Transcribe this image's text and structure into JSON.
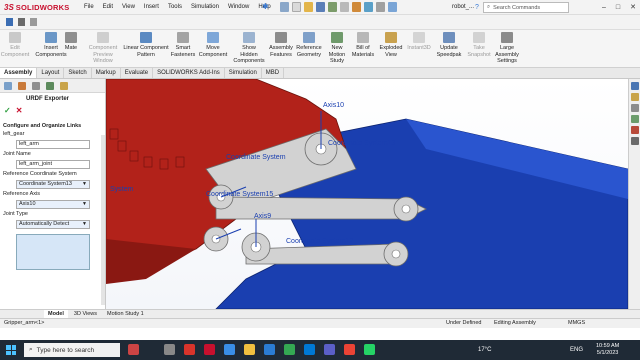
{
  "app": {
    "brand": "SOLIDWORKS",
    "doc_title": "robot_...",
    "search_placeholder": "Search Commands"
  },
  "menu": [
    "File",
    "Edit",
    "View",
    "Insert",
    "Tools",
    "Simulation",
    "Window",
    "Help"
  ],
  "ribbon": [
    {
      "label": "Edit\nComponent",
      "icon": "edit-component-icon",
      "disabled": true
    },
    {
      "label": "Insert\nComponents",
      "icon": "insert-components-icon",
      "disabled": false
    },
    {
      "label": "Mate",
      "icon": "mate-icon",
      "disabled": false
    },
    {
      "label": "Component\nPreview\nWindow",
      "icon": "component-preview-icon",
      "disabled": true
    },
    {
      "label": "Linear Component\nPattern",
      "icon": "linear-pattern-icon",
      "disabled": false
    },
    {
      "label": "Smart\nFasteners",
      "icon": "smart-fasteners-icon",
      "disabled": false
    },
    {
      "label": "Move\nComponent",
      "icon": "move-component-icon",
      "disabled": false
    },
    {
      "label": "Show\nHidden\nComponents",
      "icon": "show-hidden-icon",
      "disabled": false
    },
    {
      "label": "Assembly\nFeatures",
      "icon": "assembly-features-icon",
      "disabled": false
    },
    {
      "label": "Reference\nGeometry",
      "icon": "reference-geometry-icon",
      "disabled": false
    },
    {
      "label": "New\nMotion\nStudy",
      "icon": "motion-study-icon",
      "disabled": false
    },
    {
      "label": "Bill of\nMaterials",
      "icon": "bom-icon",
      "disabled": false
    },
    {
      "label": "Exploded\nView",
      "icon": "exploded-view-icon",
      "disabled": false
    },
    {
      "label": "Instant3D",
      "icon": "instant3d-icon",
      "disabled": true
    },
    {
      "label": "Update\nSpeedpak",
      "icon": "speedpak-icon",
      "disabled": false
    },
    {
      "label": "Take\nSnapshot",
      "icon": "snapshot-icon",
      "disabled": true
    },
    {
      "label": "Large\nAssembly\nSettings",
      "icon": "large-assembly-icon",
      "disabled": false
    }
  ],
  "tabs": [
    "Assembly",
    "Layout",
    "Sketch",
    "Markup",
    "Evaluate",
    "SOLIDWORKS Add-Ins",
    "Simulation",
    "MBD"
  ],
  "panel": {
    "title": "URDF Exporter",
    "section": "Configure and Organize Links",
    "parent_link": "left_gear",
    "link_name": "left_arm",
    "joint_name_label": "Joint Name",
    "joint_name": "left_arm_joint",
    "ref_coord_label": "Reference Coordinate System",
    "ref_coord": "Coordinate System13",
    "ref_axis_label": "Reference Axis",
    "ref_axis": "Axis10",
    "joint_type_label": "Joint Type",
    "joint_type": "Automatically Detect"
  },
  "bottom_tabs": [
    "Model",
    "3D Views",
    "Motion Study 1"
  ],
  "status": {
    "left": "Gripper_arm<1>",
    "defined": "Under Defined",
    "mode": "Editing Assembly",
    "units": "MMGS"
  },
  "viewport_labels": {
    "axis10": "Axis10",
    "axis9": "Axis9",
    "cs13": "Coordinate System13",
    "cs_mid": "Coordinate System",
    "cs15": "Coordinate System15",
    "cs12": "Coordinate System12",
    "cs_left": "System"
  },
  "taskbar": {
    "search": "Type here to search",
    "temp": "17°C",
    "lang": "ENG",
    "time": "10:59 AM",
    "date": "5/1/2023"
  },
  "colors": {
    "red_part": "#b2221a",
    "blue_part": "#1a3fb0",
    "link_grey": "#d2d2d2",
    "accent": "#c8102e"
  }
}
